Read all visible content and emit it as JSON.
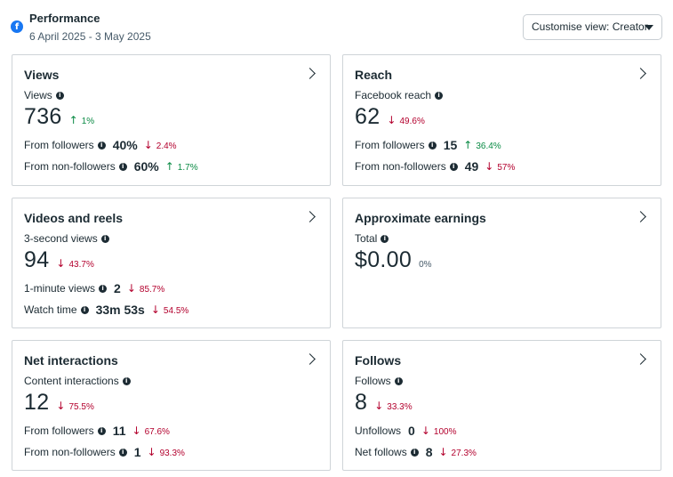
{
  "header": {
    "title": "Performance",
    "date_range": "6 April 2025 - 3 May 2025",
    "customise_label": "Customise view: Creator",
    "logo_icon": "facebook-icon"
  },
  "colors": {
    "up": "#0a8a44",
    "down": "#b3002d",
    "brand": "#1877f2"
  },
  "cards": {
    "views": {
      "title": "Views",
      "metric_label": "Views",
      "value": "736",
      "change": "1%",
      "change_dir": "up",
      "row1_label": "From followers",
      "row1_value": "40%",
      "row1_change": "2.4%",
      "row2_label": "From non-followers",
      "row2_value": "60%",
      "row2_change": "1.7%"
    },
    "reach": {
      "title": "Reach",
      "metric_label": "Facebook reach",
      "value": "62",
      "change": "49.6%",
      "row1_label": "From followers",
      "row1_value": "15",
      "row1_change": "36.4%",
      "row2_label": "From non-followers",
      "row2_value": "49",
      "row2_change": "57%"
    },
    "videos": {
      "title": "Videos and reels",
      "metric_label": "3-second views",
      "value": "94",
      "change": "43.7%",
      "row1_label": "1-minute views",
      "row1_value": "2",
      "row1_change": "85.7%",
      "row2_label": "Watch time",
      "row2_value": "33m 53s",
      "row2_change": "54.5%"
    },
    "earnings": {
      "title": "Approximate earnings",
      "metric_label": "Total",
      "value": "$0.00",
      "change": "0%"
    },
    "interactions": {
      "title": "Net interactions",
      "metric_label": "Content interactions",
      "value": "12",
      "change": "75.5%",
      "row1_label": "From followers",
      "row1_value": "11",
      "row1_change": "67.6%",
      "row2_label": "From non-followers",
      "row2_value": "1",
      "row2_change": "93.3%"
    },
    "follows": {
      "title": "Follows",
      "metric_label": "Follows",
      "value": "8",
      "change": "33.3%",
      "row1_label": "Unfollows",
      "row1_value": "0",
      "row1_change": "100%",
      "row2_label": "Net follows",
      "row2_value": "8",
      "row2_change": "27.3%"
    }
  }
}
